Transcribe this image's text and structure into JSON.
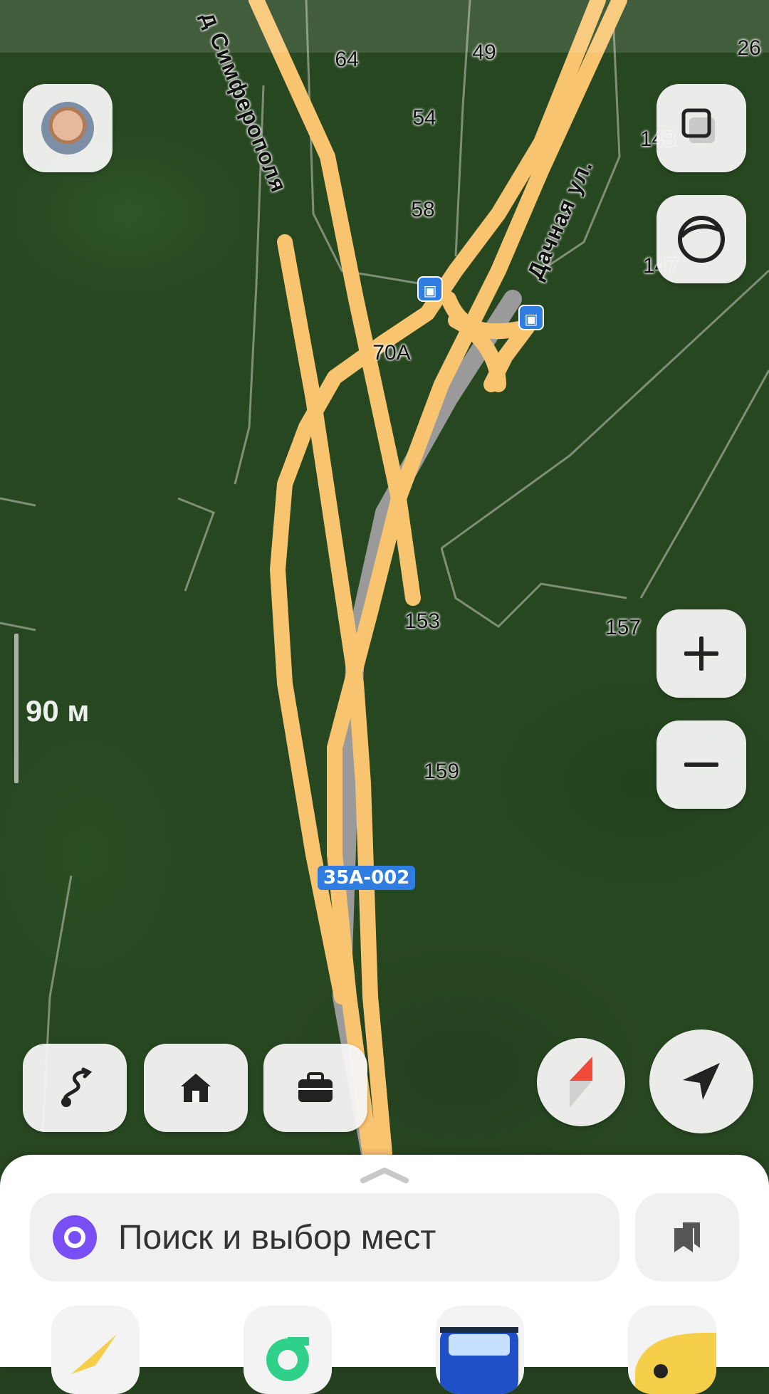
{
  "map": {
    "house_numbers": [
      "64",
      "49",
      "26",
      "54",
      "143",
      "58",
      "147",
      "153",
      "157",
      "159"
    ],
    "poi_labels": [
      "70А"
    ],
    "streets": [
      "д Симферополя",
      "Дачная ул."
    ],
    "road_badge": "35А-002",
    "scale_label": "90 м"
  },
  "search": {
    "placeholder": "Поиск и выбор мест"
  },
  "colors": {
    "road": "#f9c46f",
    "accent": "#7a4ef5",
    "compass_red": "#f04a3a",
    "badge_blue": "#2f7de1"
  },
  "icons": {
    "top_right": [
      "layers-icon",
      "circle-icon"
    ],
    "zoom": [
      "plus-icon",
      "minus-icon"
    ],
    "bottom_left": [
      "route-icon",
      "home-icon",
      "briefcase-icon"
    ],
    "bottom_right": [
      "compass-icon",
      "location-arrow-icon"
    ],
    "search": [
      "alice-icon",
      "bookmarks-icon"
    ],
    "apps": [
      "navigator-app-icon",
      "market-app-icon",
      "transport-app-icon",
      "taxi-app-icon"
    ]
  }
}
